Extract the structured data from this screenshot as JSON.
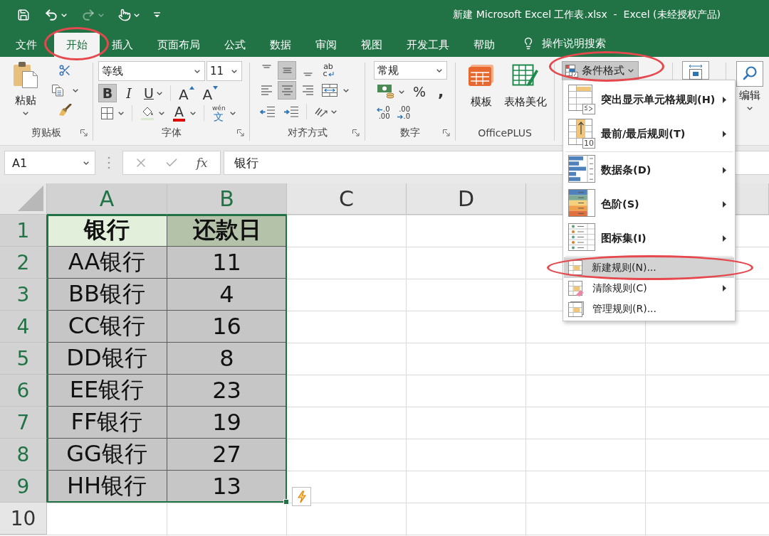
{
  "quick_access": [
    {
      "kind": "save",
      "disabled": false,
      "dropdown": false
    },
    {
      "kind": "undo",
      "disabled": false,
      "dropdown": true
    },
    {
      "kind": "redo",
      "disabled": true,
      "dropdown": true
    },
    {
      "kind": "touch",
      "disabled": false,
      "dropdown": true
    },
    {
      "kind": "customize",
      "disabled": false,
      "dropdown": false
    }
  ],
  "window": {
    "title": "新建 Microsoft Excel 工作表.xlsx  -  Excel (未经授权产品)"
  },
  "tabs": [
    {
      "label": "文件",
      "selected": false,
      "circled": false
    },
    {
      "label": "开始",
      "selected": true,
      "circled": true
    },
    {
      "label": "插入",
      "selected": false,
      "circled": false
    },
    {
      "label": "页面布局",
      "selected": false,
      "circled": false
    },
    {
      "label": "公式",
      "selected": false,
      "circled": false
    },
    {
      "label": "数据",
      "selected": false,
      "circled": false
    },
    {
      "label": "审阅",
      "selected": false,
      "circled": false
    },
    {
      "label": "视图",
      "selected": false,
      "circled": false
    },
    {
      "label": "开发工具",
      "selected": false,
      "circled": false
    },
    {
      "label": "帮助",
      "selected": false,
      "circled": false
    }
  ],
  "tell_me": {
    "placeholder": "操作说明搜索"
  },
  "ribbon": {
    "clipboard": {
      "label": "剪贴板",
      "paste": "粘贴"
    },
    "font": {
      "label": "字体",
      "font_name": "等线",
      "font_size": "11",
      "styles": [
        {
          "kind": "bold",
          "text": "B",
          "selected": true,
          "dropdown": false
        },
        {
          "kind": "italic",
          "text": "I",
          "selected": false,
          "dropdown": false
        },
        {
          "kind": "underline",
          "text": "U",
          "selected": false,
          "dropdown": true
        }
      ],
      "resize": [
        {
          "kind": "grow",
          "text": "A"
        },
        {
          "kind": "shrink",
          "text": "A"
        }
      ],
      "font_color": {
        "text": "A"
      },
      "phonetic": {
        "top": "wén",
        "bottom": "文"
      }
    },
    "alignment": {
      "label": "对齐方式",
      "vertical": [
        {
          "kind": "top",
          "selected": false
        },
        {
          "kind": "middle",
          "selected": true
        },
        {
          "kind": "bottom",
          "selected": false
        }
      ],
      "horizontal": [
        {
          "kind": "left",
          "selected": false
        },
        {
          "kind": "center",
          "selected": true
        },
        {
          "kind": "right",
          "selected": false
        }
      ],
      "wrap": {
        "top": "ab",
        "bottom": "c"
      }
    },
    "number": {
      "label": "数字",
      "format": "常规",
      "symbols": [
        {
          "kind": "percent",
          "text": "%"
        },
        {
          "kind": "comma",
          "text": ","
        }
      ],
      "decimals": [
        {
          "kind": "increase",
          "lines": [
            ".0",
            ".00"
          ]
        },
        {
          "kind": "decrease",
          "lines": [
            ".00",
            ".0"
          ]
        }
      ]
    },
    "officeplus": {
      "label": "OfficePLUS",
      "buttons": [
        {
          "kind": "template",
          "label": "模板"
        },
        {
          "kind": "beautify",
          "label": "表格美化"
        }
      ]
    },
    "styles": {
      "conditional_format": {
        "label": "条件格式",
        "pressed": true,
        "circled": true
      }
    },
    "editing": {
      "label": "编辑"
    }
  },
  "name_box": {
    "value": "A1"
  },
  "formula_bar": {
    "function_label": "fx",
    "value": "银行"
  },
  "sheet": {
    "columns": [
      {
        "label": "A",
        "selected": true
      },
      {
        "label": "B",
        "selected": true
      },
      {
        "label": "C",
        "selected": false
      },
      {
        "label": "D",
        "selected": false
      }
    ],
    "rows": [
      {
        "header": "1",
        "kind": "header",
        "selected": true,
        "cells": [
          {
            "value": "银行",
            "selected": true,
            "active": true
          },
          {
            "value": "还款日",
            "selected": true,
            "active": false
          }
        ]
      },
      {
        "header": "2",
        "kind": "data",
        "selected": true,
        "cells": [
          {
            "value": "AA银行",
            "selected": true,
            "active": false
          },
          {
            "value": "11",
            "selected": true,
            "active": false
          }
        ]
      },
      {
        "header": "3",
        "kind": "data",
        "selected": true,
        "cells": [
          {
            "value": "BB银行",
            "selected": true,
            "active": false
          },
          {
            "value": "4",
            "selected": true,
            "active": false
          }
        ]
      },
      {
        "header": "4",
        "kind": "data",
        "selected": true,
        "cells": [
          {
            "value": "CC银行",
            "selected": true,
            "active": false
          },
          {
            "value": "16",
            "selected": true,
            "active": false
          }
        ]
      },
      {
        "header": "5",
        "kind": "data",
        "selected": true,
        "cells": [
          {
            "value": "DD银行",
            "selected": true,
            "active": false
          },
          {
            "value": "8",
            "selected": true,
            "active": false
          }
        ]
      },
      {
        "header": "6",
        "kind": "data",
        "selected": true,
        "cells": [
          {
            "value": "EE银行",
            "selected": true,
            "active": false
          },
          {
            "value": "23",
            "selected": true,
            "active": false
          }
        ]
      },
      {
        "header": "7",
        "kind": "data",
        "selected": true,
        "cells": [
          {
            "value": "FF银行",
            "selected": true,
            "active": false
          },
          {
            "value": "19",
            "selected": true,
            "active": false
          }
        ]
      },
      {
        "header": "8",
        "kind": "data",
        "selected": true,
        "cells": [
          {
            "value": "GG银行",
            "selected": true,
            "active": false
          },
          {
            "value": "27",
            "selected": true,
            "active": false
          }
        ]
      },
      {
        "header": "9",
        "kind": "data",
        "selected": true,
        "cells": [
          {
            "value": "HH银行",
            "selected": true,
            "active": false
          },
          {
            "value": "13",
            "selected": true,
            "active": false
          }
        ]
      },
      {
        "header": "10",
        "kind": "data",
        "selected": false
      }
    ]
  },
  "menu": {
    "groups": [
      {
        "items": [
          {
            "kind": "large",
            "label": "突出显示单元格规则(H)",
            "submenu": true,
            "selected": false,
            "circled": false
          },
          {
            "kind": "large",
            "label": "最前/最后规则(T)",
            "submenu": true,
            "selected": false,
            "circled": false,
            "icon_badge": "10"
          }
        ]
      },
      {
        "items": [
          {
            "kind": "large",
            "label": "数据条(D)",
            "submenu": true,
            "selected": false,
            "circled": false
          },
          {
            "kind": "large",
            "label": "色阶(S)",
            "submenu": true,
            "selected": false,
            "circled": false
          },
          {
            "kind": "large",
            "label": "图标集(I)",
            "submenu": true,
            "selected": false,
            "circled": false
          }
        ]
      },
      {
        "items": [
          {
            "kind": "small",
            "label": "新建规则(N)...",
            "submenu": false,
            "selected": true,
            "circled": true
          },
          {
            "kind": "small",
            "label": "清除规则(C)",
            "submenu": true,
            "selected": false,
            "circled": false
          },
          {
            "kind": "small",
            "label": "管理规则(R)...",
            "submenu": false,
            "selected": false,
            "circled": false
          }
        ]
      }
    ]
  }
}
